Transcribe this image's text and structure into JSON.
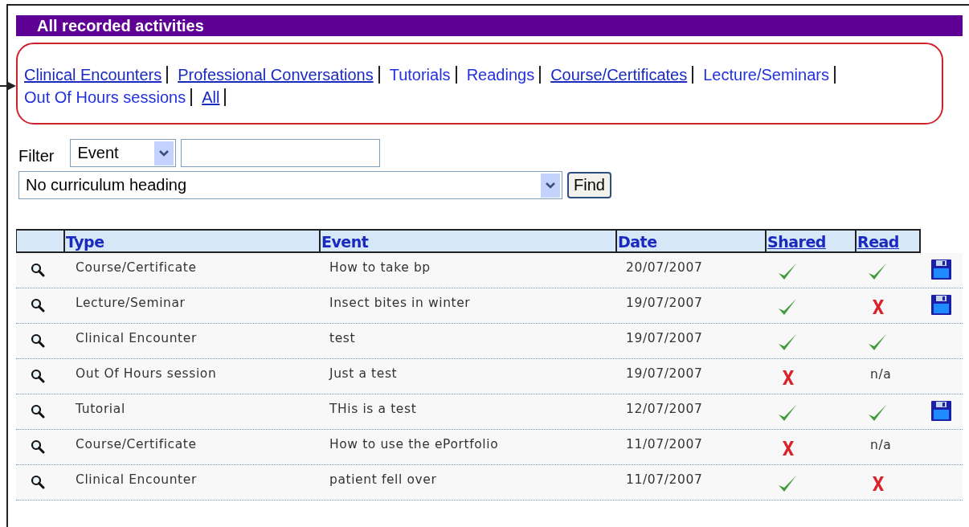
{
  "title": "All recorded activities",
  "categories": [
    {
      "label": "Clinical Encounters",
      "underlined": true
    },
    {
      "label": "Professional Conversations",
      "underlined": true
    },
    {
      "label": "Tutorials",
      "underlined": false
    },
    {
      "label": "Readings",
      "underlined": false
    },
    {
      "label": "Course/Certificates",
      "underlined": true
    },
    {
      "label": "Lecture/Seminars",
      "underlined": false
    },
    {
      "label": "Out Of Hours sessions",
      "underlined": false
    },
    {
      "label": "All",
      "underlined": true
    }
  ],
  "filter": {
    "label": "Filter",
    "field_select": "Event",
    "curriculum_select": "No curriculum heading",
    "button": "Find"
  },
  "table": {
    "columns": [
      {
        "label": "Type",
        "underlined": false
      },
      {
        "label": "Event",
        "underlined": false
      },
      {
        "label": "Date",
        "underlined": false
      },
      {
        "label": "Shared",
        "underlined": true
      },
      {
        "label": "Read",
        "underlined": true
      }
    ],
    "rows": [
      {
        "type": "Course/Certificate",
        "event": "How to take bp",
        "date": "20/07/2007",
        "shared": {
          "kind": "check"
        },
        "read": {
          "kind": "check"
        },
        "saved": true
      },
      {
        "type": "Lecture/Seminar",
        "event": "Insect bites in winter",
        "date": "19/07/2007",
        "shared": {
          "kind": "check"
        },
        "read": {
          "kind": "cross"
        },
        "saved": true
      },
      {
        "type": "Clinical Encounter",
        "event": "test",
        "date": "19/07/2007",
        "shared": {
          "kind": "check"
        },
        "read": {
          "kind": "check"
        },
        "saved": false
      },
      {
        "type": "Out Of Hours session",
        "event": "Just a test",
        "date": "19/07/2007",
        "shared": {
          "kind": "cross"
        },
        "read": {
          "kind": "text",
          "text": "n/a"
        },
        "saved": false
      },
      {
        "type": "Tutorial",
        "event": "THis is a test",
        "date": "12/07/2007",
        "shared": {
          "kind": "check"
        },
        "read": {
          "kind": "check"
        },
        "saved": true
      },
      {
        "type": "Course/Certificate",
        "event": "How to use the ePortfolio",
        "date": "11/07/2007",
        "shared": {
          "kind": "cross"
        },
        "read": {
          "kind": "text",
          "text": "n/a"
        },
        "saved": false
      },
      {
        "type": "Clinical Encounter",
        "event": "patient fell over",
        "date": "11/07/2007",
        "shared": {
          "kind": "check"
        },
        "read": {
          "kind": "cross"
        },
        "saved": false
      }
    ]
  }
}
